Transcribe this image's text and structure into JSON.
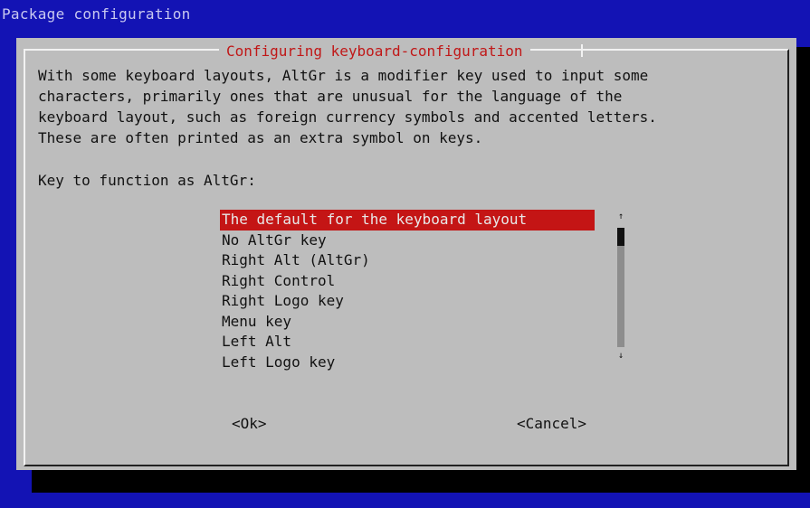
{
  "screen": {
    "title": "Package configuration"
  },
  "dialog": {
    "title": "Configuring keyboard-configuration",
    "description": "With some keyboard layouts, AltGr is a modifier key used to input some\ncharacters, primarily ones that are unusual for the language of the\nkeyboard layout, such as foreign currency symbols and accented letters.\nThese are often printed as an extra symbol on keys.",
    "prompt": "Key to function as AltGr:",
    "options": [
      "The default for the keyboard layout",
      "No AltGr key",
      "Right Alt (AltGr)",
      "Right Control",
      "Right Logo key",
      "Menu key",
      "Left Alt",
      "Left Logo key"
    ],
    "selected_option": "The default for the keyboard layout",
    "buttons": {
      "ok": "<Ok>",
      "cancel": "<Cancel>"
    }
  },
  "scrollbar": {
    "up_icon": "scroll-up-arrow-icon",
    "down_icon": "scroll-down-arrow-icon"
  },
  "colors": {
    "background": "#1313b4",
    "dialog": "#bdbdbd",
    "title_text": "#c01818",
    "selection": "#c41515"
  }
}
